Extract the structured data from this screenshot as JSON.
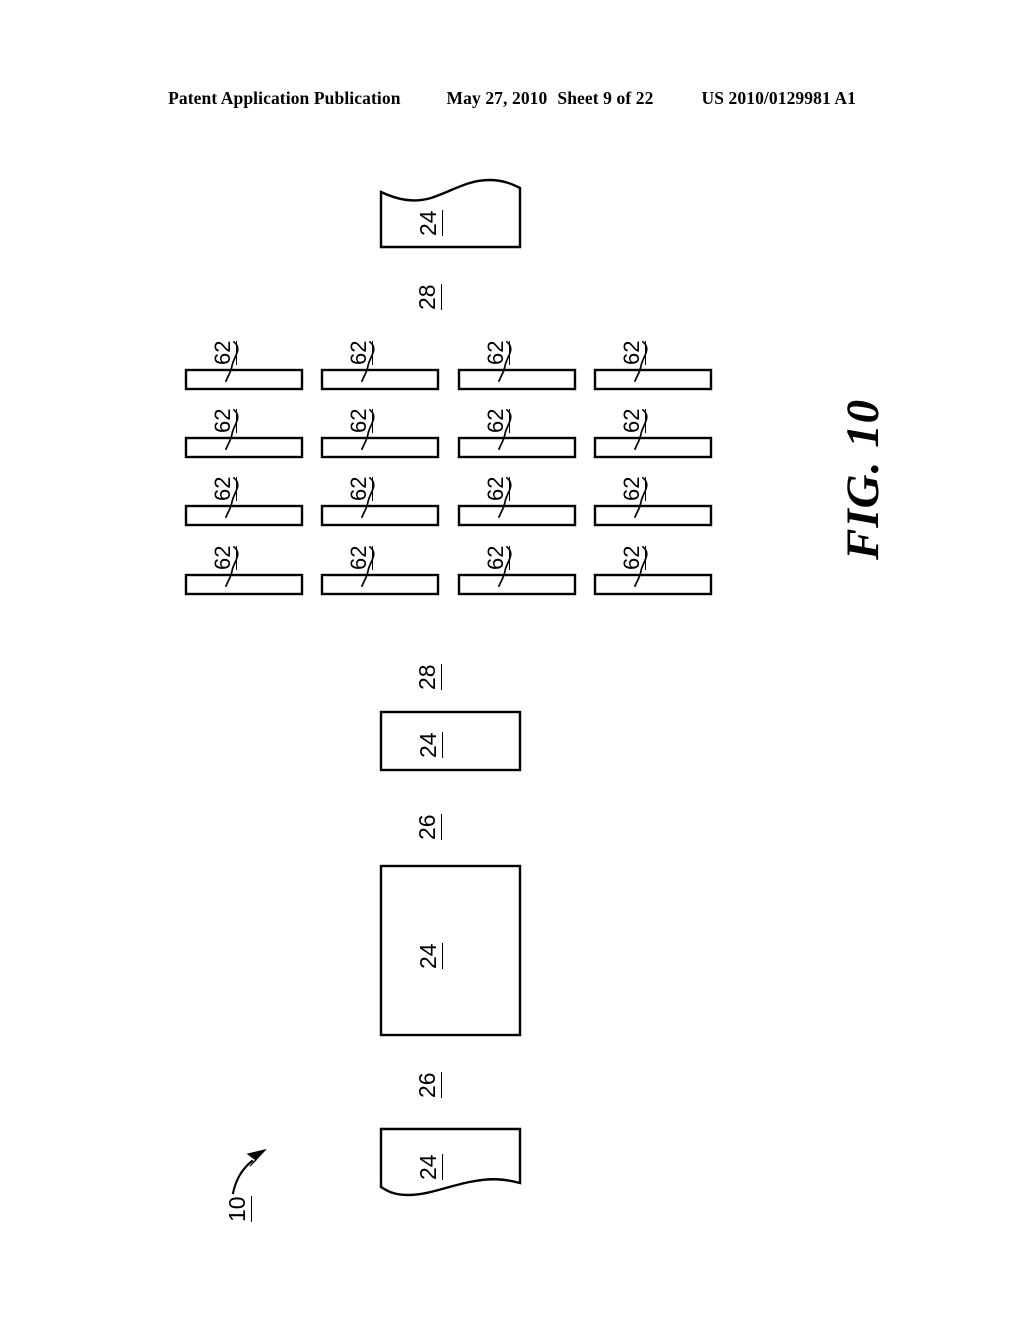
{
  "header": {
    "publication": "Patent Application Publication",
    "date": "May 27, 2010",
    "sheet": "Sheet 9 of 22",
    "doc_number": "US 2010/0129981 A1"
  },
  "figure": {
    "title": "FIG. 10",
    "assembly_label": "10",
    "colors": {
      "line": "#000000",
      "fill": "#ffffff",
      "background": "#ffffff"
    },
    "labels": {
      "substrate": "24",
      "gap_28": "28",
      "gap_26": "26",
      "element_62": "62"
    },
    "layers": [
      {
        "name": "top-broken-substrate",
        "label": "24",
        "shape": "broken-wavy-top"
      },
      {
        "name": "spacing-28-top",
        "label": "28",
        "shape": "gap-callout"
      },
      {
        "name": "element-grid",
        "label": "62",
        "rows": 4,
        "cols": 4,
        "count": 16
      },
      {
        "name": "spacing-28-bottom",
        "label": "28",
        "shape": "gap-callout"
      },
      {
        "name": "middle-substrate",
        "label": "24",
        "shape": "rectangle"
      },
      {
        "name": "spacing-26-upper",
        "label": "26",
        "shape": "gap-callout"
      },
      {
        "name": "large-substrate",
        "label": "24",
        "shape": "rectangle"
      },
      {
        "name": "spacing-26-lower",
        "label": "26",
        "shape": "gap-callout"
      },
      {
        "name": "bottom-broken-substrate",
        "label": "24",
        "shape": "broken-wavy-bottom"
      }
    ],
    "element_grid": {
      "label": "62",
      "row_count": 4,
      "col_count": 4,
      "cells": [
        {
          "row": 1,
          "col": 1,
          "label": "62"
        },
        {
          "row": 1,
          "col": 2,
          "label": "62"
        },
        {
          "row": 1,
          "col": 3,
          "label": "62"
        },
        {
          "row": 1,
          "col": 4,
          "label": "62"
        },
        {
          "row": 2,
          "col": 1,
          "label": "62"
        },
        {
          "row": 2,
          "col": 2,
          "label": "62"
        },
        {
          "row": 2,
          "col": 3,
          "label": "62"
        },
        {
          "row": 2,
          "col": 4,
          "label": "62"
        },
        {
          "row": 3,
          "col": 1,
          "label": "62"
        },
        {
          "row": 3,
          "col": 2,
          "label": "62"
        },
        {
          "row": 3,
          "col": 3,
          "label": "62"
        },
        {
          "row": 3,
          "col": 4,
          "label": "62"
        },
        {
          "row": 4,
          "col": 1,
          "label": "62"
        },
        {
          "row": 4,
          "col": 2,
          "label": "62"
        },
        {
          "row": 4,
          "col": 3,
          "label": "62"
        },
        {
          "row": 4,
          "col": 4,
          "label": "62"
        }
      ]
    }
  }
}
